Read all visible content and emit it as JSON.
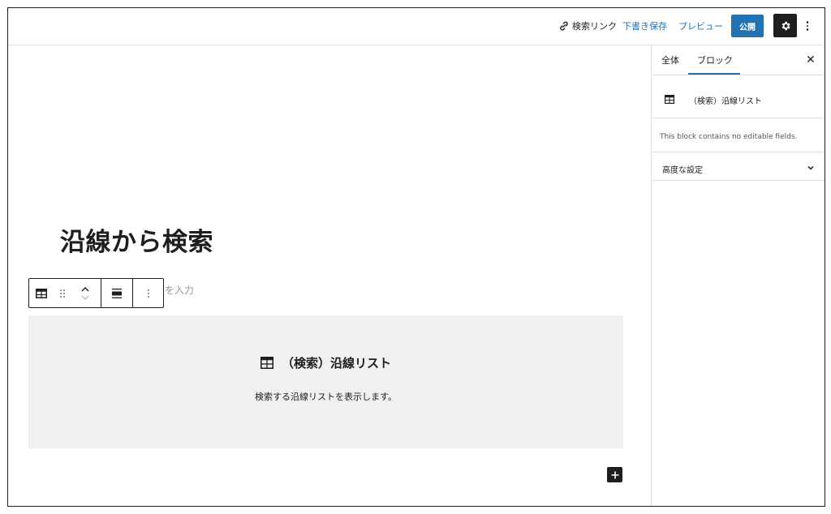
{
  "topbar": {
    "search_link": "検索リンク",
    "draft": "下書き保存",
    "preview": "プレビュー",
    "publish": "公開"
  },
  "sidebar": {
    "tabs": [
      "全体",
      "ブロック"
    ],
    "active_tab": "ブロック",
    "block_title": "（検索）沿線リスト",
    "no_fields": "This block contains no editable fields.",
    "advanced": "高度な設定"
  },
  "editor": {
    "post_title": "沿線から検索",
    "placeholder_tail": "を入力",
    "block": {
      "title": "（検索）沿線リスト",
      "description": "検索する沿線リストを表示します。"
    }
  },
  "colors": {
    "accent": "#2271b1",
    "dark": "#1e1e1e",
    "block_bg": "#f0f0f0"
  },
  "icons": [
    "link-icon",
    "gear-icon",
    "more-vertical-icon",
    "close-icon",
    "table-icon",
    "drag-handle-icon",
    "chevron-up-icon",
    "chevron-down-icon",
    "align-icon",
    "plus-icon"
  ]
}
